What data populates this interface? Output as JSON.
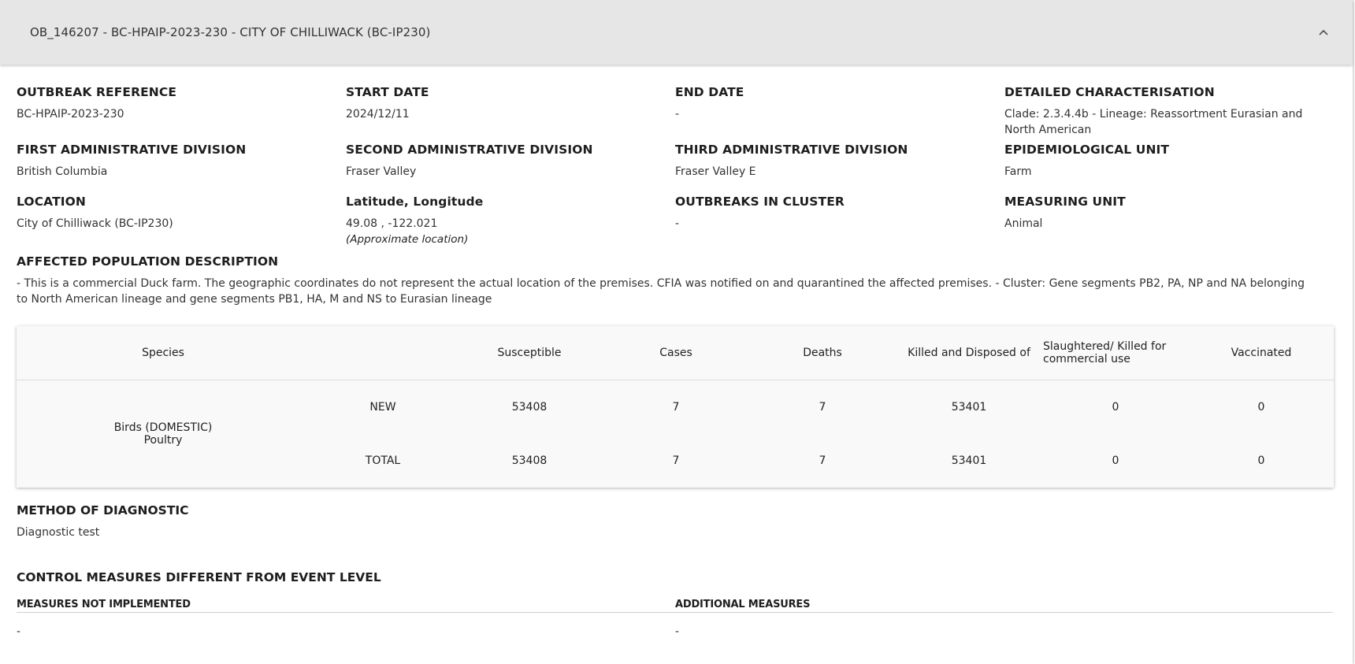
{
  "header": {
    "title": "OB_146207 - BC-HPAIP-2023-230 - CITY OF CHILLIWACK (BC-IP230)"
  },
  "fields": {
    "outbreak_reference": {
      "label": "OUTBREAK REFERENCE",
      "value": "BC-HPAIP-2023-230"
    },
    "start_date": {
      "label": "START DATE",
      "value": "2024/12/11"
    },
    "end_date": {
      "label": "END DATE",
      "value": "-"
    },
    "detailed_characterisation": {
      "label": "DETAILED CHARACTERISATION",
      "value": "Clade: 2.3.4.4b - Lineage: Reassortment Eurasian and North American"
    },
    "first_admin_division": {
      "label": "FIRST ADMINISTRATIVE DIVISION",
      "value": "British Columbia"
    },
    "second_admin_division": {
      "label": "SECOND ADMINISTRATIVE DIVISION",
      "value": "Fraser Valley"
    },
    "third_admin_division": {
      "label": "THIRD ADMINISTRATIVE DIVISION",
      "value": "Fraser Valley E"
    },
    "epidemiological_unit": {
      "label": "EPIDEMIOLOGICAL UNIT",
      "value": "Farm"
    },
    "location": {
      "label": "LOCATION",
      "value": "City of Chilliwack (BC-IP230)"
    },
    "lat_long": {
      "label": "Latitude, Longitude",
      "value": "49.08 , -122.021",
      "note": "(Approximate location)"
    },
    "outbreaks_in_cluster": {
      "label": "OUTBREAKS IN CLUSTER",
      "value": "-"
    },
    "measuring_unit": {
      "label": "MEASURING UNIT",
      "value": "Animal"
    },
    "affected_population": {
      "label": "AFFECTED POPULATION DESCRIPTION",
      "value": "- This is a commercial Duck farm. The geographic coordinates do not represent the actual location of the premises. CFIA was notified on and quarantined the affected premises. - Cluster: Gene segments PB2, PA, NP and NA belonging to North American lineage and gene segments PB1, HA, M and NS to Eurasian lineage"
    }
  },
  "table": {
    "headers": {
      "species": "Species",
      "susceptible": "Susceptible",
      "cases": "Cases",
      "deaths": "Deaths",
      "killed_disposed": "Killed and Disposed of",
      "slaughtered": "Slaughtered/ Killed for commercial use",
      "vaccinated": "Vaccinated"
    },
    "species_line1": "Birds (DOMESTIC)",
    "species_line2": "Poultry",
    "rows": [
      {
        "type": "NEW",
        "susceptible": "53408",
        "cases": "7",
        "deaths": "7",
        "killed_disposed": "53401",
        "slaughtered": "0",
        "vaccinated": "0"
      },
      {
        "type": "TOTAL",
        "susceptible": "53408",
        "cases": "7",
        "deaths": "7",
        "killed_disposed": "53401",
        "slaughtered": "0",
        "vaccinated": "0"
      }
    ]
  },
  "method_of_diagnostic": {
    "label": "METHOD OF DIAGNOSTIC",
    "value": "Diagnostic test"
  },
  "control_measures": {
    "title": "CONTROL MEASURES DIFFERENT FROM EVENT LEVEL",
    "not_implemented_label": "MEASURES NOT IMPLEMENTED",
    "not_implemented_value": "-",
    "additional_label": "ADDITIONAL MEASURES",
    "additional_value": "-"
  },
  "icons": {
    "toggle": "chevron-up-icon"
  }
}
